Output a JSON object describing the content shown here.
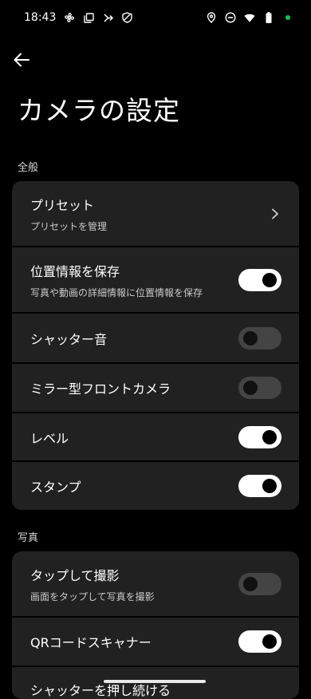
{
  "status": {
    "time": "18:43",
    "left_icons": [
      "fan-icon",
      "copy-icon",
      "tilt-arrow-icon",
      "shield-icon"
    ],
    "right_icons": [
      "location-icon",
      "dnd-icon",
      "wifi-icon",
      "battery-icon",
      "dot-icon"
    ],
    "dot_color": "#00c853"
  },
  "page": {
    "title": "カメラの設定"
  },
  "sections": {
    "general": {
      "label": "全般",
      "rows": [
        {
          "title": "プリセット",
          "subtitle": "プリセットを管理",
          "control": "chevron"
        },
        {
          "title": "位置情報を保存",
          "subtitle": "写真や動画の詳細情報に位置情報を保存",
          "control": "toggle",
          "on": true
        },
        {
          "title": "シャッター音",
          "control": "toggle",
          "on": false
        },
        {
          "title": "ミラー型フロントカメラ",
          "control": "toggle",
          "on": false
        },
        {
          "title": "レベル",
          "control": "toggle",
          "on": true
        },
        {
          "title": "スタンプ",
          "control": "toggle",
          "on": true
        }
      ]
    },
    "photo": {
      "label": "写真",
      "rows": [
        {
          "title": "タップして撮影",
          "subtitle": "画面をタップして写真を撮影",
          "control": "toggle",
          "on": false
        },
        {
          "title": "QRコードスキャナー",
          "control": "toggle",
          "on": true
        },
        {
          "title": "シャッターを押し続ける"
        }
      ]
    }
  }
}
